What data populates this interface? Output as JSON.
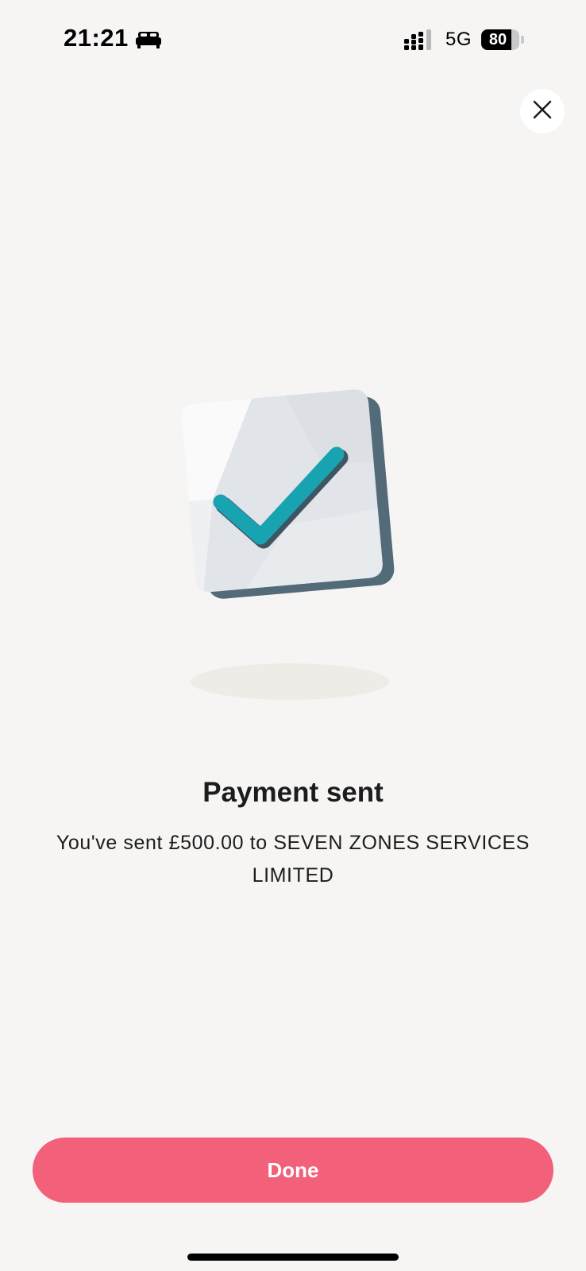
{
  "status_bar": {
    "time": "21:21",
    "network": "5G",
    "battery": "80",
    "battery_level": 0.8,
    "icons": [
      "bed-icon",
      "signal-icon",
      "battery-icon"
    ]
  },
  "header": {
    "close_icon": "close-icon"
  },
  "illustration": {
    "icon": "checkmark-card-icon",
    "check_color": "#18a3b0",
    "card_shadow_color": "#536a78"
  },
  "content": {
    "title": "Payment sent",
    "message": "You've sent £500.00 to SEVEN ZONES SERVICES LIMITED"
  },
  "footer": {
    "done_label": "Done",
    "done_color": "#f2607a"
  }
}
